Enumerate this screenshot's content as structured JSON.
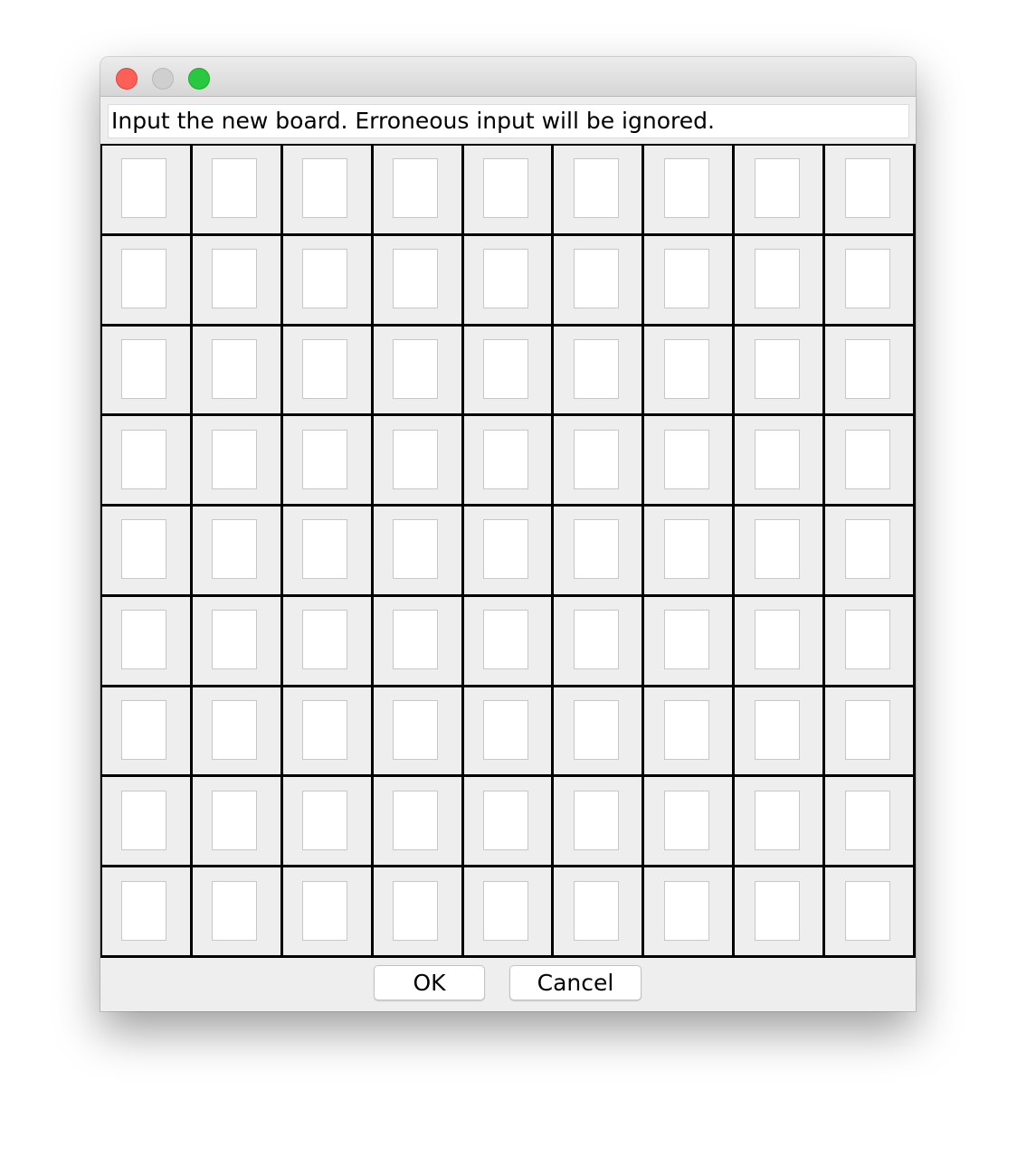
{
  "window": {
    "title": ""
  },
  "message": {
    "text": "Input the new board. Erroneous input will be ignored."
  },
  "board": {
    "rows": 9,
    "cols": 9,
    "values": [
      [
        "",
        "",
        "",
        "",
        "",
        "",
        "",
        "",
        ""
      ],
      [
        "",
        "",
        "",
        "",
        "",
        "",
        "",
        "",
        ""
      ],
      [
        "",
        "",
        "",
        "",
        "",
        "",
        "",
        "",
        ""
      ],
      [
        "",
        "",
        "",
        "",
        "",
        "",
        "",
        "",
        ""
      ],
      [
        "",
        "",
        "",
        "",
        "",
        "",
        "",
        "",
        ""
      ],
      [
        "",
        "",
        "",
        "",
        "",
        "",
        "",
        "",
        ""
      ],
      [
        "",
        "",
        "",
        "",
        "",
        "",
        "",
        "",
        ""
      ],
      [
        "",
        "",
        "",
        "",
        "",
        "",
        "",
        "",
        ""
      ],
      [
        "",
        "",
        "",
        "",
        "",
        "",
        "",
        "",
        ""
      ]
    ]
  },
  "buttons": {
    "ok_label": "OK",
    "cancel_label": "Cancel"
  },
  "colors": {
    "close": "#fe5f57",
    "minimize": "#cfcfcf",
    "zoom": "#28c840",
    "grid_line": "#000000",
    "background": "#eeeeee"
  },
  "icons": {
    "close": "close-button-dot",
    "minimize": "minimize-button-dot",
    "zoom": "zoom-button-dot"
  }
}
